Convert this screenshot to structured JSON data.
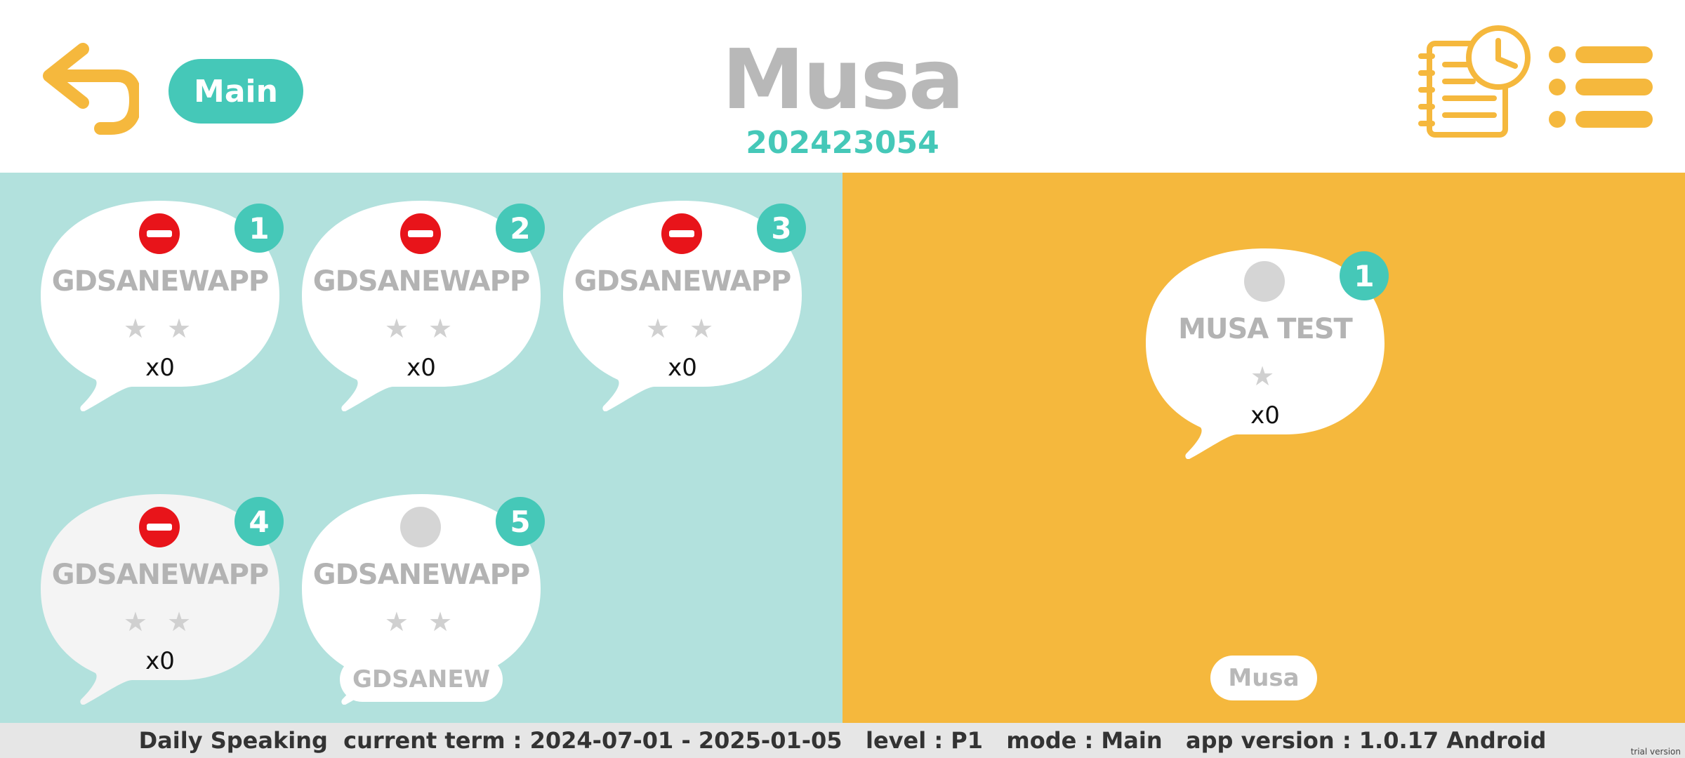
{
  "header": {
    "main_label": "Main",
    "student_name": "Musa",
    "student_id": "202423054"
  },
  "icons": {
    "back": "back-arrow-icon",
    "schedule": "schedule-clipboard-icon",
    "menu": "list-menu-icon",
    "blocked": "no-entry-icon",
    "star": "star-icon"
  },
  "colors": {
    "accent_teal": "#45c8b8",
    "accent_orange": "#f5b83d",
    "left_panel": "#b2e1dd",
    "blocked_red": "#e8141a"
  },
  "left_panel": {
    "cards": [
      {
        "number": "1",
        "title": "GDSANEWAPP",
        "stars": "★ ★",
        "count": "x0",
        "status": "blocked"
      },
      {
        "number": "2",
        "title": "GDSANEWAPP",
        "stars": "★ ★",
        "count": "x0",
        "status": "blocked"
      },
      {
        "number": "3",
        "title": "GDSANEWAPP",
        "stars": "★ ★",
        "count": "x0",
        "status": "blocked"
      },
      {
        "number": "4",
        "title": "GDSANEWAPP",
        "stars": "★ ★",
        "count": "x0",
        "status": "blocked"
      },
      {
        "number": "5",
        "title": "GDSANEWAPP",
        "stars": "★ ★",
        "count": "",
        "status": "idle"
      }
    ],
    "floating_tag": "GDSANEW"
  },
  "right_panel": {
    "cards": [
      {
        "number": "1",
        "title": "MUSA TEST",
        "stars": "★",
        "count": "x0",
        "status": "idle"
      }
    ],
    "floating_tag": "Musa"
  },
  "footer": {
    "status_text": "Daily Speaking  current term : 2024-07-01 - 2025-01-05   level : P1   mode : Main   app version : 1.0.17 Android",
    "watermark": "trial version"
  }
}
